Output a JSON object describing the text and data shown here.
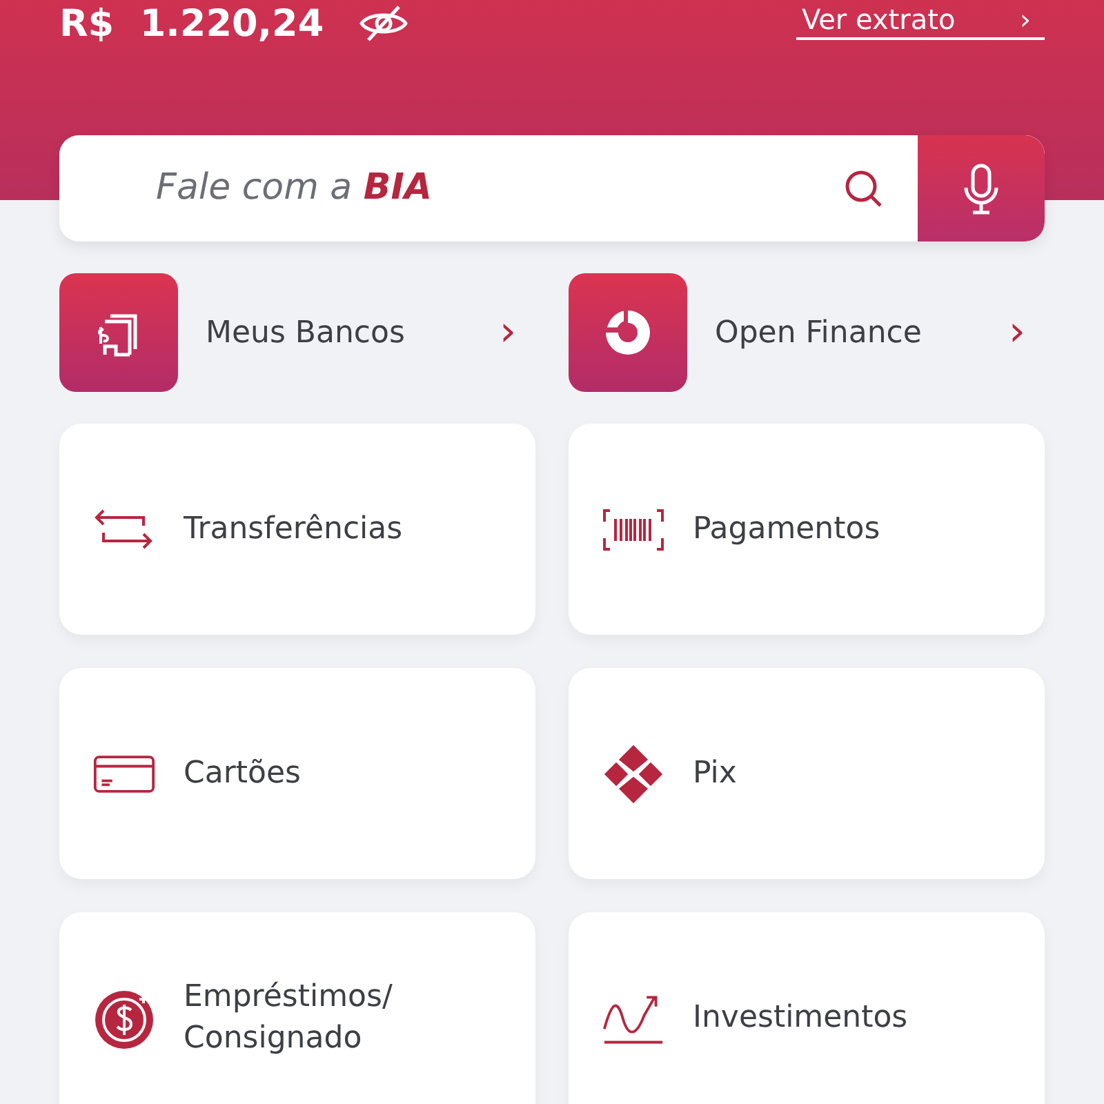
{
  "header": {
    "balance": "R$  1.220,24",
    "statement_link": "Ver extrato",
    "statement_arrow": "›"
  },
  "search": {
    "placeholder": "Fale com a **BIA**"
  },
  "shortcuts": [
    {
      "label": "Meus Bancos",
      "chevron": "›"
    },
    {
      "label": "Open Finance",
      "chevron": "›"
    }
  ],
  "services": [
    {
      "label": "Transferências"
    },
    {
      "label": "Pagamentos"
    },
    {
      "label": "Cartões"
    },
    {
      "label": "Pix"
    },
    {
      "label": "Empréstimos/ Consignado"
    },
    {
      "label": "Investimentos"
    }
  ]
}
